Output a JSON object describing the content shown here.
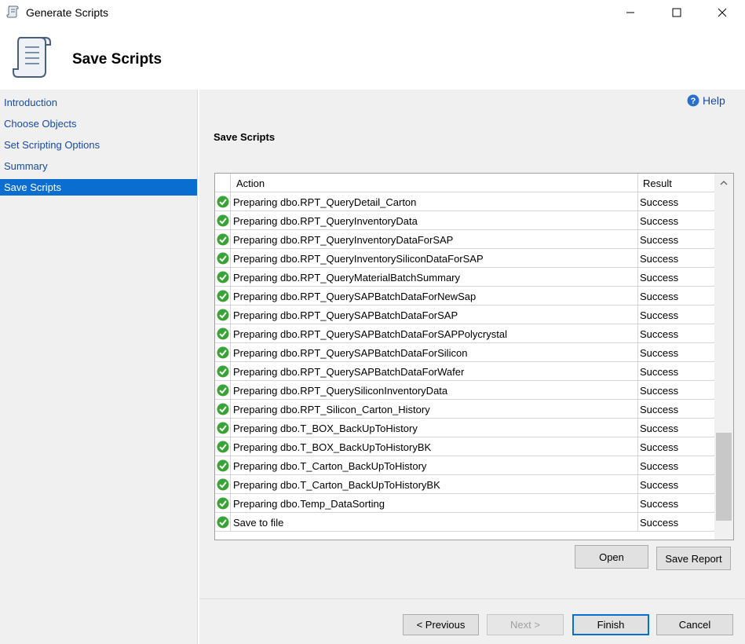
{
  "window": {
    "title": "Generate Scripts",
    "controls": {
      "minimize": "minimize",
      "maximize": "maximize",
      "close": "close"
    }
  },
  "header": {
    "heading": "Save Scripts"
  },
  "nav": {
    "items": [
      {
        "label": "Introduction",
        "active": false
      },
      {
        "label": "Choose Objects",
        "active": false
      },
      {
        "label": "Set Scripting Options",
        "active": false
      },
      {
        "label": "Summary",
        "active": false
      },
      {
        "label": "Save Scripts",
        "active": true
      }
    ]
  },
  "main": {
    "help_label": "Help",
    "section_title": "Save Scripts",
    "grid": {
      "columns": {
        "action": "Action",
        "result": "Result"
      },
      "rows": [
        {
          "action": "Preparing dbo.RPT_QueryDetail_Carton",
          "result": "Success"
        },
        {
          "action": "Preparing dbo.RPT_QueryInventoryData",
          "result": "Success"
        },
        {
          "action": "Preparing dbo.RPT_QueryInventoryDataForSAP",
          "result": "Success"
        },
        {
          "action": "Preparing dbo.RPT_QueryInventorySiliconDataForSAP",
          "result": "Success"
        },
        {
          "action": "Preparing dbo.RPT_QueryMaterialBatchSummary",
          "result": "Success"
        },
        {
          "action": "Preparing dbo.RPT_QuerySAPBatchDataForNewSap",
          "result": "Success"
        },
        {
          "action": "Preparing dbo.RPT_QuerySAPBatchDataForSAP",
          "result": "Success"
        },
        {
          "action": "Preparing dbo.RPT_QuerySAPBatchDataForSAPPolycrystal",
          "result": "Success"
        },
        {
          "action": "Preparing dbo.RPT_QuerySAPBatchDataForSilicon",
          "result": "Success"
        },
        {
          "action": "Preparing dbo.RPT_QuerySAPBatchDataForWafer",
          "result": "Success"
        },
        {
          "action": "Preparing dbo.RPT_QuerySiliconInventoryData",
          "result": "Success"
        },
        {
          "action": "Preparing dbo.RPT_Silicon_Carton_History",
          "result": "Success"
        },
        {
          "action": "Preparing dbo.T_BOX_BackUpToHistory",
          "result": "Success"
        },
        {
          "action": "Preparing dbo.T_BOX_BackUpToHistoryBK",
          "result": "Success"
        },
        {
          "action": "Preparing dbo.T_Carton_BackUpToHistory",
          "result": "Success"
        },
        {
          "action": "Preparing dbo.T_Carton_BackUpToHistoryBK",
          "result": "Success"
        },
        {
          "action": "Preparing dbo.Temp_DataSorting",
          "result": "Success"
        },
        {
          "action": "Save to file",
          "result": "Success"
        }
      ]
    },
    "buttons": {
      "open": "Open",
      "save_report": "Save Report"
    }
  },
  "footer": {
    "previous": "< Previous",
    "next": "Next >",
    "finish": "Finish",
    "cancel": "Cancel"
  },
  "colors": {
    "accent": "#0a6ed1",
    "link": "#1a4aa0",
    "success_icon": "#3aa335"
  }
}
